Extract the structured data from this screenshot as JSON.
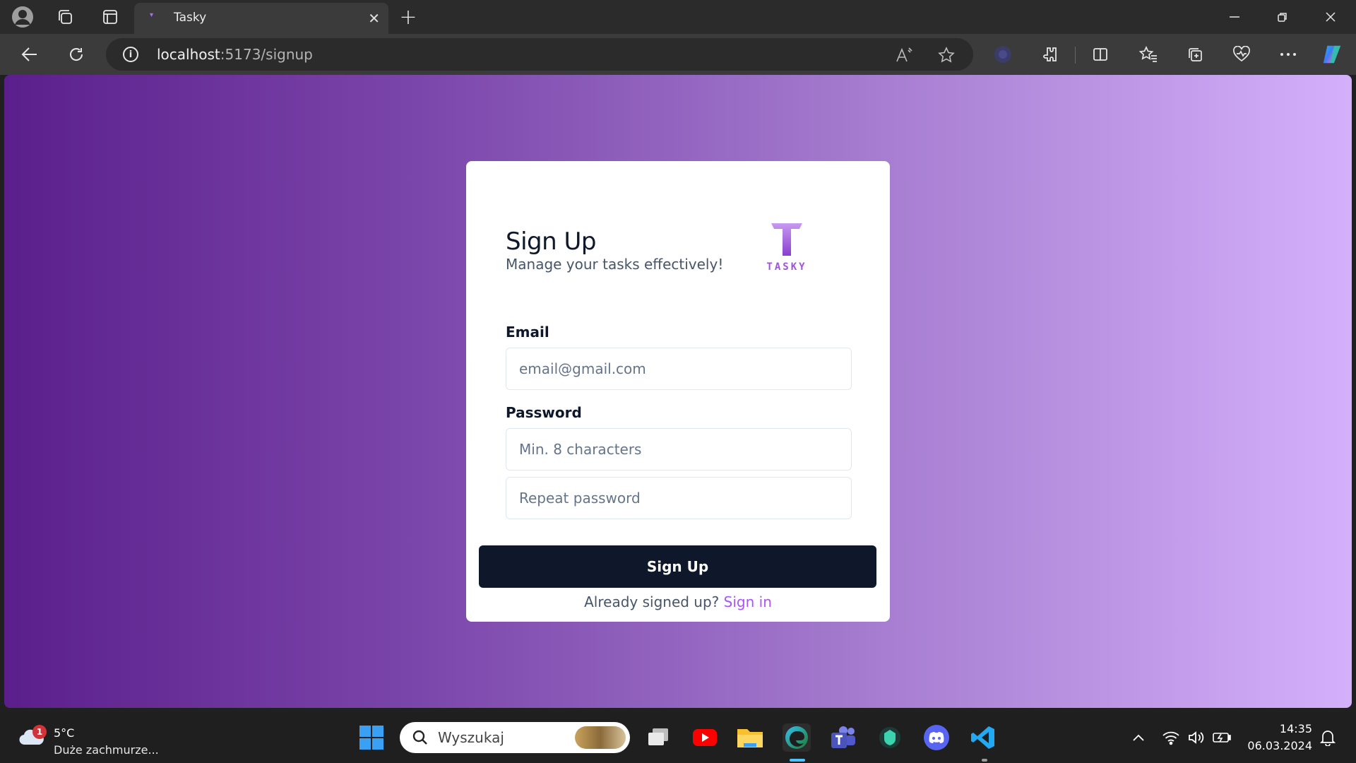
{
  "browser": {
    "tab_title": "Tasky",
    "url_host": "localhost",
    "url_rest": ":5173/signup"
  },
  "page": {
    "title": "Sign Up",
    "subtitle": "Manage your tasks effectively!",
    "logo_text": "TASKY",
    "email_label": "Email",
    "email_placeholder": "email@gmail.com",
    "password_label": "Password",
    "password_placeholder": "Min. 8 characters",
    "repeat_placeholder": "Repeat password",
    "submit_label": "Sign Up",
    "footer_text": "Already signed up?",
    "footer_link": "Sign in"
  },
  "taskbar": {
    "weather_temp": "5°C",
    "weather_desc": "Duże zachmurze...",
    "weather_badge": "1",
    "search_text": "Wyszukaj",
    "time": "14:35",
    "date": "06.03.2024"
  },
  "colors": {
    "accent": "#a855f7",
    "button": "#0f172a",
    "gradient_start": "#5b1f8c",
    "gradient_end": "#d4b0fb"
  }
}
